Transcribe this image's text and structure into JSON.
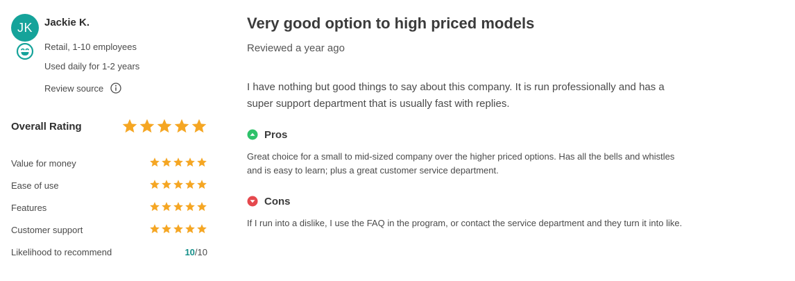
{
  "reviewer": {
    "initials": "JK",
    "name": "Jackie K.",
    "company": "Retail, 1-10 employees",
    "usage": "Used daily for 1-2 years",
    "source_label": "Review source"
  },
  "overall": {
    "label": "Overall Rating",
    "stars": 5
  },
  "ratings": [
    {
      "label": "Value for money",
      "stars": 5
    },
    {
      "label": "Ease of use",
      "stars": 5
    },
    {
      "label": "Features",
      "stars": 5
    },
    {
      "label": "Customer support",
      "stars": 5
    }
  ],
  "recommend": {
    "label": "Likelihood to recommend",
    "score": "10",
    "max": "/10"
  },
  "review": {
    "title": "Very good option to high priced models",
    "date": "Reviewed a year ago",
    "body": "I have nothing but good things to say about this company. It is run professionally and has a super support department that is usually fast with replies.",
    "pros_heading": "Pros",
    "pros_text": "Great choice for a small to mid-sized company over the higher priced options. Has all the bells and whistles and is easy to learn; plus a great customer service department.",
    "cons_heading": "Cons",
    "cons_text": "If I run into a dislike, I use the FAQ in the program, or contact the service department and they turn it into like."
  },
  "colors": {
    "avatar": "#15a39a",
    "star": "#f5a623",
    "pros": "#2ec26a",
    "cons": "#e5484d",
    "score": "#15908a"
  },
  "icons": {
    "smiley": "smiley-icon",
    "info": "info-icon",
    "star": "star-icon",
    "pros": "pros-up-icon",
    "cons": "cons-down-icon"
  }
}
